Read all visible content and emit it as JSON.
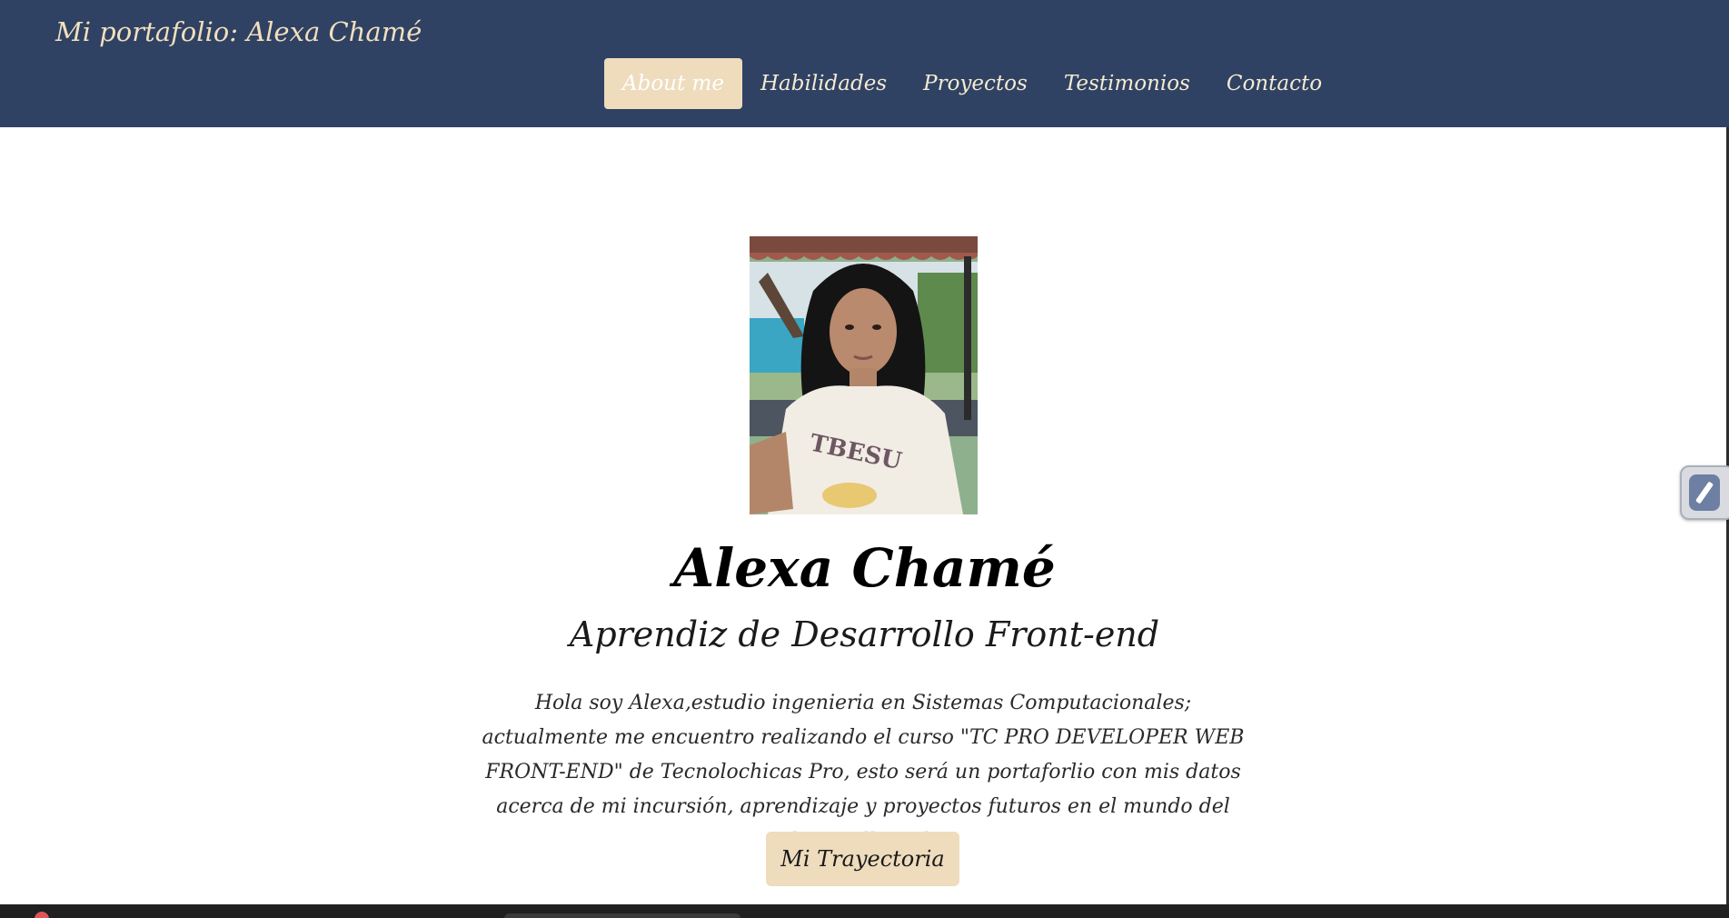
{
  "header": {
    "brand": "Mi portafolio: Alexa Chamé",
    "nav": [
      {
        "label": "About me",
        "active": true
      },
      {
        "label": "Habilidades",
        "active": false
      },
      {
        "label": "Proyectos",
        "active": false
      },
      {
        "label": "Testimonios",
        "active": false
      },
      {
        "label": "Contacto",
        "active": false
      }
    ]
  },
  "hero": {
    "photo_alt": "profile-photo",
    "name": "Alexa Chamé",
    "role": "Aprendiz de Desarrollo Front-end",
    "bio": "Hola soy Alexa,estudio ingenieria en Sistemas Computacionales; actualmente me encuentro realizando el curso \"TC PRO DEVELOPER WEB FRONT-END\" de Tecnolochicas Pro, esto será un portaforlio con mis datos acerca de mi incursión, aprendizaje y proyectos futuros en el mundo del desarrollo web.",
    "cta_label": "Mi Trayectoria"
  },
  "colors": {
    "header_bg": "#2f4263",
    "accent": "#eedcbd",
    "brand_text": "#f2dfbe"
  },
  "icons": {
    "side_widget": "bolt-icon"
  }
}
